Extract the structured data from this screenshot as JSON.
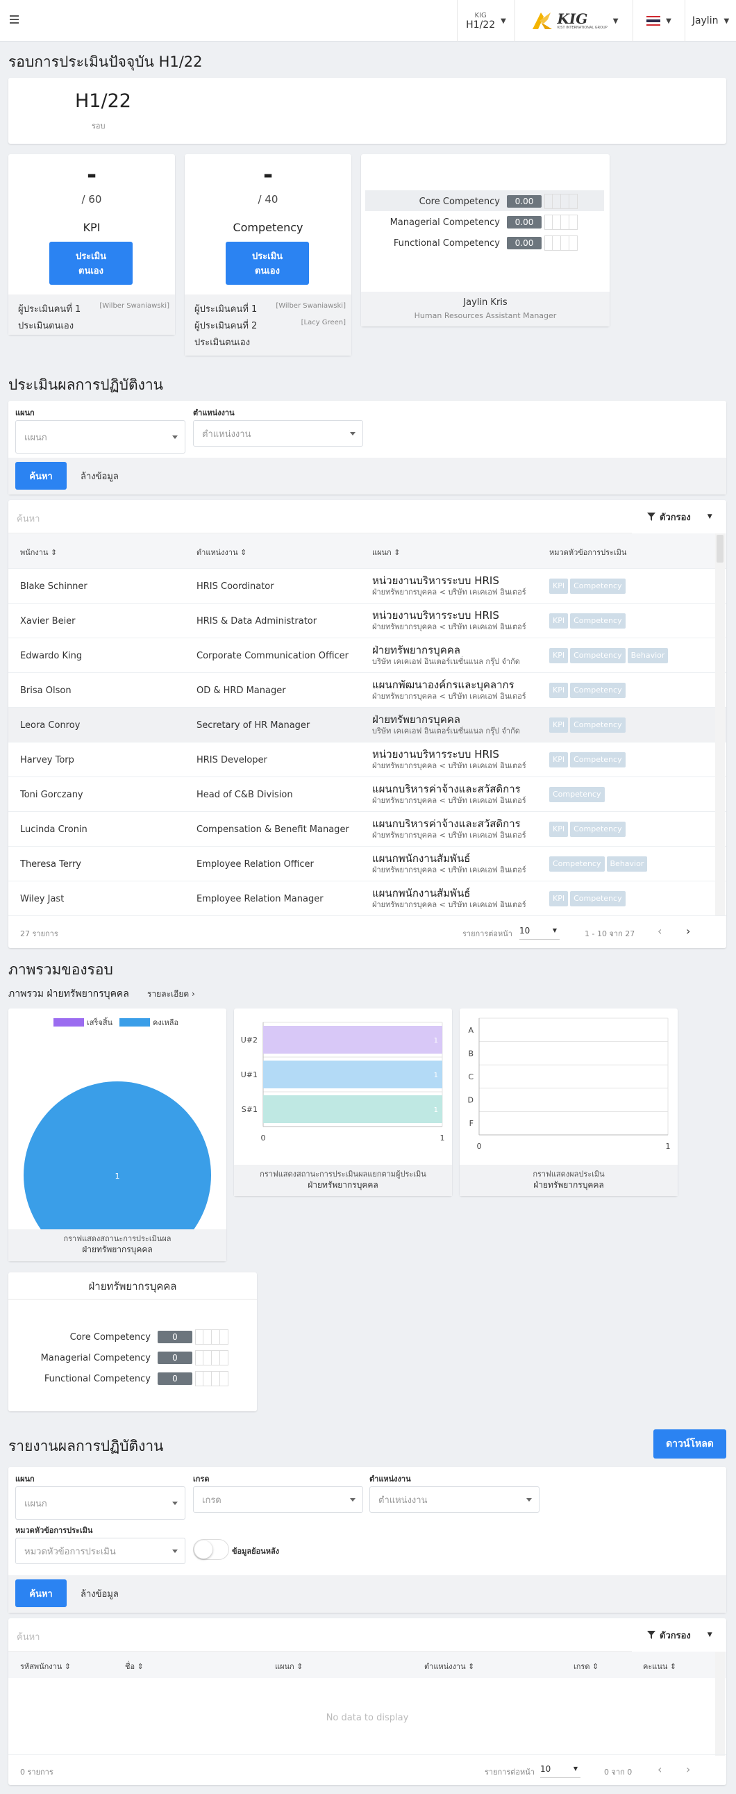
{
  "topbar": {
    "company_code": "KIG",
    "period": "H1/22",
    "logo_text": "KIG",
    "logo_sub": "KIST INTERNATIONAL GROUP",
    "user": "Jaylin"
  },
  "current_round": {
    "title": "รอบการประเมินปัจจุบัน H1/22",
    "round_value": "H1/22",
    "round_label": "รอบ"
  },
  "kpi_card": {
    "value": "-",
    "total": "/ 60",
    "name": "KPI",
    "button_line1": "ประเมิน",
    "button_line2": "ตนเอง",
    "evaluator_label": "ผู้ประเมินคนที่ 1",
    "evaluator_name": "[Wilber Swaniawski]",
    "self_label": "ประเมินตนเอง"
  },
  "competency_card": {
    "value": "-",
    "total": "/ 40",
    "name": "Competency",
    "button_line1": "ประเมิน",
    "button_line2": "ตนเอง",
    "evaluator1_label": "ผู้ประเมินคนที่ 1",
    "evaluator1_name": "[Wilber Swaniawski]",
    "evaluator2_label": "ผู้ประเมินคนที่ 2",
    "evaluator2_name": "[Lacy Green]",
    "self_label": "ประเมินตนเอง"
  },
  "profile_card": {
    "rows": [
      {
        "label": "Core Competency",
        "value": "0.00"
      },
      {
        "label": "Managerial Competency",
        "value": "0.00"
      },
      {
        "label": "Functional Competency",
        "value": "0.00"
      }
    ],
    "name": "Jaylin Kris",
    "position": "Human Resources Assistant Manager"
  },
  "evaluation": {
    "title": "ประเมินผลการปฏิบัติงาน",
    "filter_dept_label": "แผนก",
    "filter_dept_placeholder": "แผนก",
    "filter_pos_label": "ตำแหน่งงาน",
    "filter_pos_placeholder": "ตำแหน่งงาน",
    "search_button": "ค้นหา",
    "clear_button": "ล้างข้อมูล",
    "search_placeholder": "ค้นหา",
    "filter_button": "ตัวกรอง",
    "columns": [
      "พนักงาน",
      "ตำแหน่งงาน",
      "แผนก",
      "หมวดหัวข้อการประเมิน"
    ],
    "rows": [
      {
        "name": "Blake Schinner",
        "position": "HRIS Coordinator",
        "dept": "หน่วยงานบริหารระบบ HRIS",
        "sub": "ฝ่ายทรัพยากรบุคคล < บริษัท เคเคเอฟ อินเตอร์",
        "tags": [
          "KPI",
          "Competency"
        ]
      },
      {
        "name": "Xavier Beier",
        "position": "HRIS & Data Administrator",
        "dept": "หน่วยงานบริหารระบบ HRIS",
        "sub": "ฝ่ายทรัพยากรบุคคล < บริษัท เคเคเอฟ อินเตอร์",
        "tags": [
          "KPI",
          "Competency"
        ]
      },
      {
        "name": "Edwardo King",
        "position": "Corporate Communication Officer",
        "dept": "ฝ่ายทรัพยากรบุคคล",
        "sub": "บริษัท เคเคเอฟ อินเตอร์เนชั่นแนล กรุ๊ป จำกัด",
        "tags": [
          "KPI",
          "Competency",
          "Behavior"
        ]
      },
      {
        "name": "Brisa Olson",
        "position": "OD & HRD Manager",
        "dept": "แผนกพัฒนาองค์กรและบุคลากร",
        "sub": "ฝ่ายทรัพยากรบุคคล < บริษัท เคเคเอฟ อินเตอร์",
        "tags": [
          "KPI",
          "Competency"
        ]
      },
      {
        "name": "Leora Conroy",
        "position": "Secretary of HR Manager",
        "dept": "ฝ่ายทรัพยากรบุคคล",
        "sub": "บริษัท เคเคเอฟ อินเตอร์เนชั่นแนล กรุ๊ป จำกัด",
        "tags": [
          "KPI",
          "Competency"
        ]
      },
      {
        "name": "Harvey Torp",
        "position": "HRIS Developer",
        "dept": "หน่วยงานบริหารระบบ HRIS",
        "sub": "ฝ่ายทรัพยากรบุคคล < บริษัท เคเคเอฟ อินเตอร์",
        "tags": [
          "KPI",
          "Competency"
        ]
      },
      {
        "name": "Toni Gorczany",
        "position": "Head of C&B Division",
        "dept": "แผนกบริหารค่าจ้างและสวัสดิการ",
        "sub": "ฝ่ายทรัพยากรบุคคล < บริษัท เคเคเอฟ อินเตอร์",
        "tags": [
          "Competency"
        ]
      },
      {
        "name": "Lucinda Cronin",
        "position": "Compensation & Benefit Manager",
        "dept": "แผนกบริหารค่าจ้างและสวัสดิการ",
        "sub": "ฝ่ายทรัพยากรบุคคล < บริษัท เคเคเอฟ อินเตอร์",
        "tags": [
          "KPI",
          "Competency"
        ]
      },
      {
        "name": "Theresa Terry",
        "position": "Employee Relation Officer",
        "dept": "แผนกพนักงานสัมพันธ์",
        "sub": "ฝ่ายทรัพยากรบุคคล < บริษัท เคเคเอฟ อินเตอร์",
        "tags": [
          "Competency",
          "Behavior"
        ]
      },
      {
        "name": "Wiley Jast",
        "position": "Employee Relation Manager",
        "dept": "แผนกพนักงานสัมพันธ์",
        "sub": "ฝ่ายทรัพยากรบุคคล < บริษัท เคเคเอฟ อินเตอร์",
        "tags": [
          "KPI",
          "Competency"
        ]
      }
    ],
    "total_text": "27 รายการ",
    "per_page_label": "รายการต่อหน้า",
    "per_page_value": "10",
    "range_text": "1 - 10 จาก 27"
  },
  "overview": {
    "title": "ภาพรวมของรอบ",
    "subtitle": "ภาพรวม ฝ่ายทรัพยากรบุคคล",
    "detail_link": "รายละเอียด",
    "pie_caption1": "กราฟแสดงสถานะการประเมินผล",
    "pie_caption2": "ฝ่ายทรัพยากรบุคคล",
    "bar_caption1": "กราฟแสดงสถานะการประเมินผลแยกตามผู้ประเมิน",
    "bar_caption2": "ฝ่ายทรัพยากรบุคคล",
    "grade_caption1": "กราฟแสดงผลประเมิน",
    "grade_caption2": "ฝ่ายทรัพยากรบุคคล",
    "dept_card_title": "ฝ่ายทรัพยากรบุคคล",
    "dept_rows": [
      {
        "label": "Core Competency",
        "value": "0"
      },
      {
        "label": "Managerial Competency",
        "value": "0"
      },
      {
        "label": "Functional Competency",
        "value": "0"
      }
    ]
  },
  "chart_data": [
    {
      "type": "pie",
      "legend": [
        "เสร็จสิ้น",
        "คงเหลือ"
      ],
      "colors": [
        "#9b6cf0",
        "#3a9ee8"
      ],
      "values": [
        0,
        1
      ],
      "labels": [
        "",
        "1"
      ]
    },
    {
      "type": "bar",
      "orientation": "horizontal",
      "categories": [
        "U#2",
        "U#1",
        "S#1"
      ],
      "values": [
        1,
        1,
        1
      ],
      "colors": [
        "#d8c8f7",
        "#b3daf6",
        "#bfe8e3"
      ],
      "xlim": [
        0,
        1
      ],
      "xticks": [
        "0",
        "1"
      ]
    },
    {
      "type": "bar",
      "orientation": "horizontal",
      "categories": [
        "A",
        "B",
        "C",
        "D",
        "F"
      ],
      "values": [
        0,
        0,
        0,
        0,
        0
      ],
      "xlim": [
        0,
        1
      ],
      "xticks": [
        "0",
        "1"
      ]
    }
  ],
  "report": {
    "title": "รายงานผลการปฏิบัติงาน",
    "download_button": "ดาวน์โหลด",
    "dept_label": "แผนก",
    "dept_placeholder": "แผนก",
    "grade_label": "เกรด",
    "grade_placeholder": "เกรด",
    "pos_label": "ตำแหน่งงาน",
    "pos_placeholder": "ตำแหน่งงาน",
    "category_label": "หมวดหัวข้อการประเมิน",
    "category_placeholder": "หมวดหัวข้อการประเมิน",
    "toggle_label": "ข้อมูลย้อนหลัง",
    "search_button": "ค้นหา",
    "clear_button": "ล้างข้อมูล",
    "search_placeholder": "ค้นหา",
    "filter_button": "ตัวกรอง",
    "columns": [
      "รหัสพนักงาน",
      "ชื่อ",
      "แผนก",
      "ตำแหน่งงาน",
      "เกรด",
      "คะแนน"
    ],
    "empty_text": "No data to display",
    "total_text": "0 รายการ",
    "per_page_label": "รายการต่อหน้า",
    "per_page_value": "10",
    "range_text": "0 จาก 0"
  }
}
